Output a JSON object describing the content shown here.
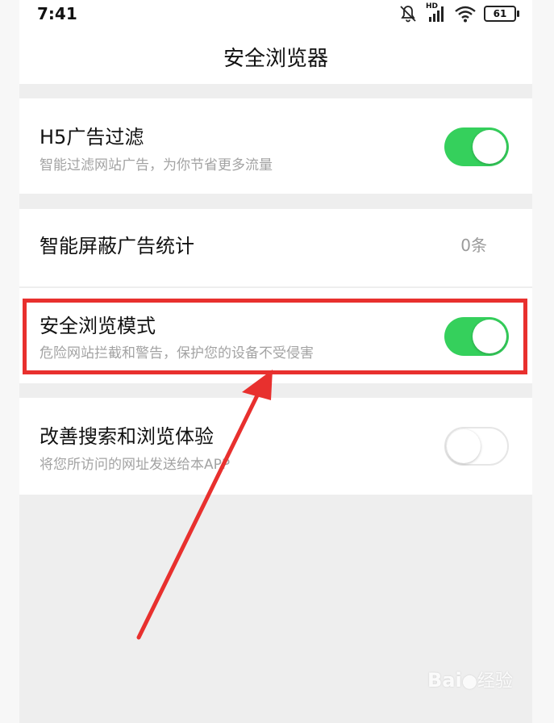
{
  "status_bar": {
    "time": "7:41",
    "network_label": "HD",
    "battery": "61",
    "icons": [
      "mute-icon",
      "signal-icon",
      "wifi-icon",
      "battery-icon"
    ]
  },
  "header": {
    "title": "安全浏览器"
  },
  "settings": {
    "h5_ad_filter": {
      "title": "H5广告过滤",
      "subtitle": "智能过滤网站广告，为你节省更多流量",
      "enabled": true
    },
    "ad_block_stats": {
      "title": "智能屏蔽广告统计",
      "value": "0条"
    },
    "safe_browsing": {
      "title": "安全浏览模式",
      "subtitle": "危险网站拦截和警告，保护您的设备不受侵害",
      "enabled": true
    },
    "improve_search": {
      "title": "改善搜索和浏览体验",
      "subtitle": "将您所访问的网址发送给本APP",
      "enabled": false
    }
  },
  "annotation": {
    "highlight_color": "#e8302e",
    "toggle_on_color": "#35d05c"
  },
  "watermark": {
    "brand": "Bai",
    "brand_cn": "经验"
  }
}
